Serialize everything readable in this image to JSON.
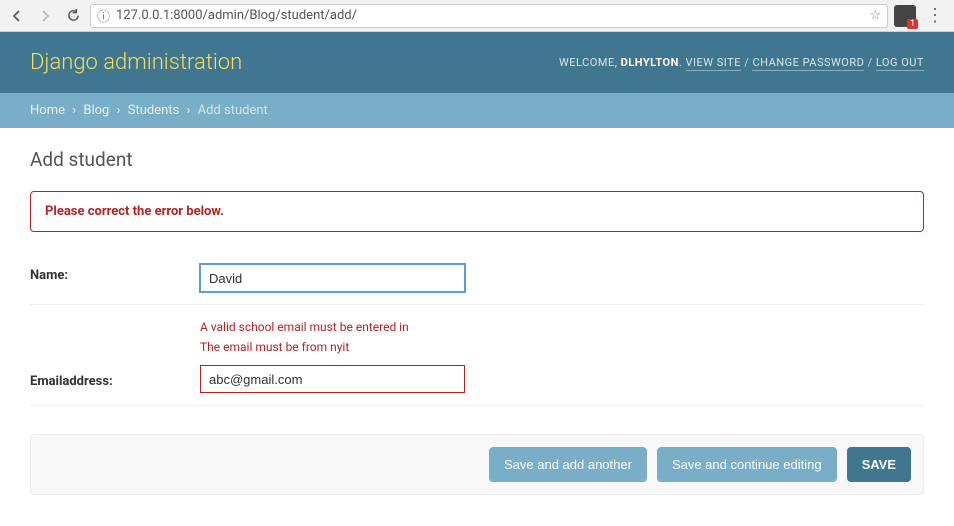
{
  "browser": {
    "url": "127.0.0.1:8000/admin/Blog/student/add/"
  },
  "header": {
    "site_title": "Django administration",
    "welcome": "WELCOME,",
    "username": "DLHYLTON",
    "view_site": "VIEW SITE",
    "change_password": "CHANGE PASSWORD",
    "log_out": "LOG OUT"
  },
  "breadcrumbs": {
    "home": "Home",
    "app": "Blog",
    "model": "Students",
    "current": "Add student"
  },
  "page": {
    "title": "Add student",
    "errornote": "Please correct the error below."
  },
  "fields": {
    "name": {
      "label": "Name:",
      "value": "David"
    },
    "email": {
      "label": "Emailaddress:",
      "value": "abc@gmail.com",
      "errors": [
        "A valid school email must be entered in",
        "The email must be from nyit"
      ]
    }
  },
  "buttons": {
    "save_add": "Save and add another",
    "save_continue": "Save and continue editing",
    "save": "SAVE"
  }
}
